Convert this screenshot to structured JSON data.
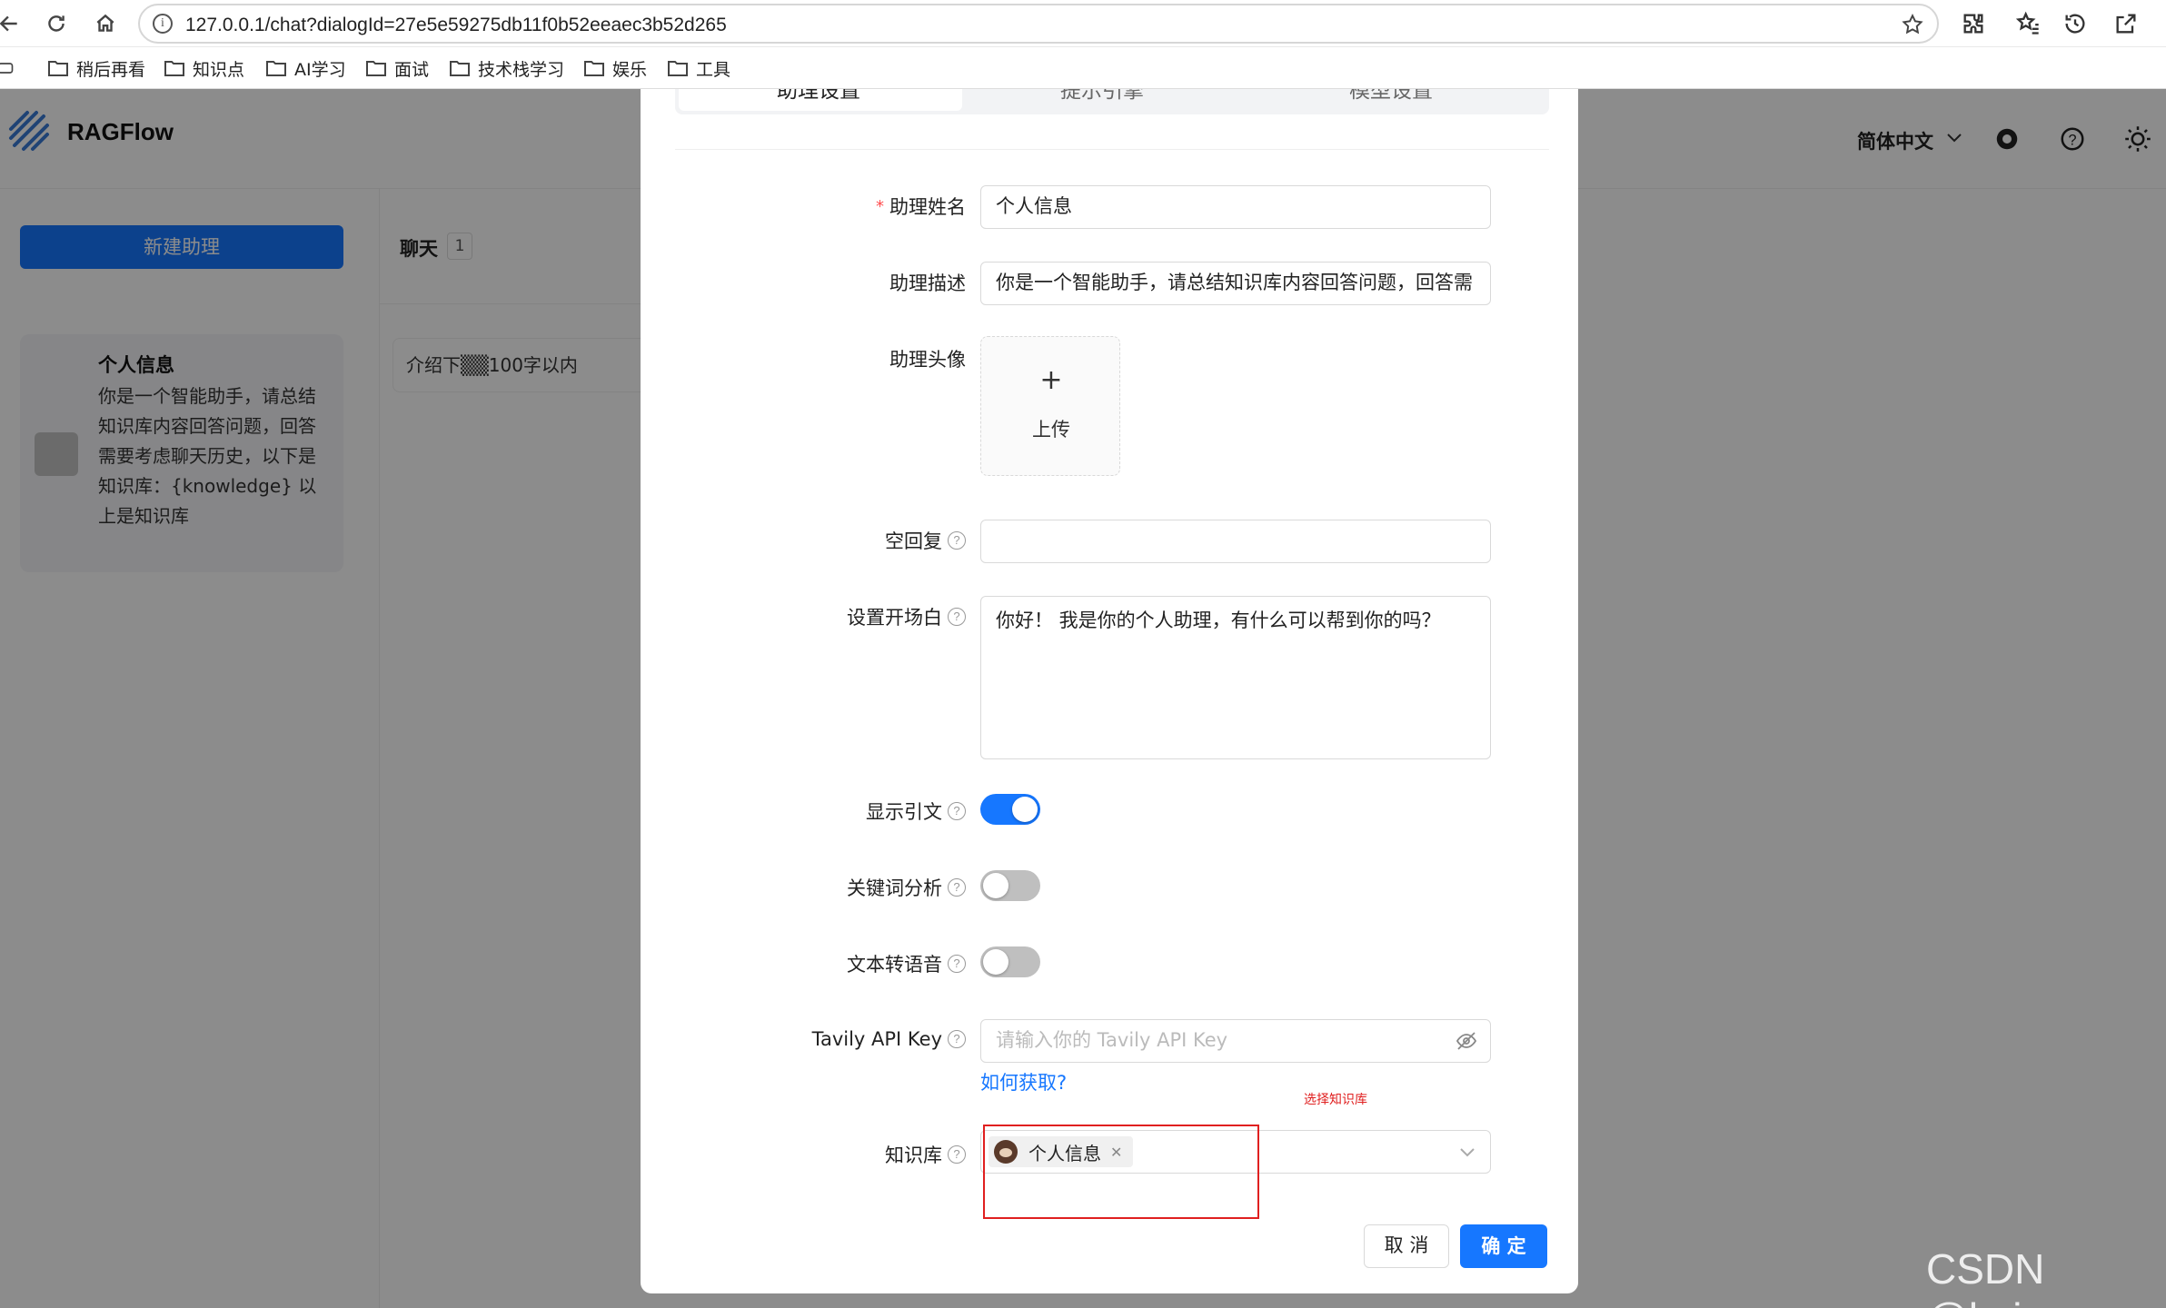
{
  "browser": {
    "url": "127.0.0.1/chat?dialogId=27e5e59275db11f0b52eeaec3b52d265",
    "bookmarks": [
      "稍后再看",
      "知识点",
      "AI学习",
      "面试",
      "技术栈学习",
      "娱乐",
      "工具"
    ]
  },
  "app": {
    "name": "RAGFlow",
    "language": "简体中文",
    "new_assistant_label": "新建助理",
    "assistant_card": {
      "title": "个人信息",
      "description": "你是一个智能助手，请总结知识库内容回答问题，回答需要考虑聊天历史，以下是知识库：{knowledge} 以上是知识库"
    },
    "chat": {
      "title": "聊天",
      "count": "1",
      "item": "介绍下▒▒100字以内"
    }
  },
  "modal": {
    "tabs": [
      "助理设置",
      "提示引擎",
      "模型设置"
    ],
    "fields": {
      "name_label": "助理姓名",
      "name_value": "个人信息",
      "desc_label": "助理描述",
      "desc_value": "你是一个智能助手，请总结知识库内容回答问题，回答需",
      "avatar_label": "助理头像",
      "upload_label": "上传",
      "empty_reply_label": "空回复",
      "empty_reply_value": "",
      "opener_label": "设置开场白",
      "opener_value": "你好！ 我是你的个人助理，有什么可以帮到你的吗？",
      "quote_label": "显示引文",
      "quote_on": true,
      "keyword_label": "关键词分析",
      "keyword_on": false,
      "tts_label": "文本转语音",
      "tts_on": false,
      "tavily_label": "Tavily API Key",
      "tavily_placeholder": "请输入你的 Tavily API Key",
      "tavily_help_link": "如何获取?",
      "kb_label": "知识库",
      "kb_selected": "个人信息",
      "annotation": "选择知识库"
    },
    "cancel_label": "取 消",
    "ok_label": "确 定"
  },
  "watermark": "CSDN @hxj..",
  "colors": {
    "primary": "#1677ff",
    "annotation": "#e02020"
  }
}
